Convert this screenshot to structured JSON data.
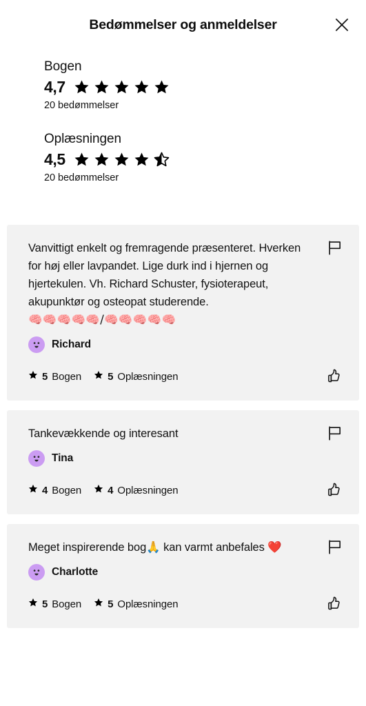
{
  "header": {
    "title": "Bedømmelser og anmeldelser",
    "close_label": "close-icon"
  },
  "summary": [
    {
      "label": "Bogen",
      "score": "4,7",
      "stars_full": 5,
      "stars_half": 0,
      "count_text": "20 bedømmelser"
    },
    {
      "label": "Oplæsningen",
      "score": "4,5",
      "stars_full": 4,
      "stars_half": 1,
      "count_text": "20 bedømmelser"
    }
  ],
  "reviews": [
    {
      "text": "Vanvittigt enkelt og fremragende præsenteret. Hverken for høj eller lavpandet. Lige durk ind i hjernen og hjertekulen. Vh. Richard Schuster, fysioterapeut, akupunktør og osteopat studerende.",
      "emoji_line": "🧠🧠🧠🧠🧠/🧠🧠🧠🧠🧠",
      "reviewer": "Richard",
      "ratings": [
        {
          "value": "5",
          "name": "Bogen"
        },
        {
          "value": "5",
          "name": "Oplæsningen"
        }
      ],
      "flag_label": "flag-icon",
      "like_label": "thumbs-up-icon"
    },
    {
      "text": "Tankevækkende og interesant",
      "emoji_line": "",
      "reviewer": "Tina",
      "ratings": [
        {
          "value": "4",
          "name": "Bogen"
        },
        {
          "value": "4",
          "name": "Oplæsningen"
        }
      ],
      "flag_label": "flag-icon",
      "like_label": "thumbs-up-icon"
    },
    {
      "text": "Meget inspirerende bog🙏 kan varmt anbefales ❤️",
      "emoji_line": "",
      "reviewer": "Charlotte",
      "ratings": [
        {
          "value": "5",
          "name": "Bogen"
        },
        {
          "value": "5",
          "name": "Oplæsningen"
        }
      ],
      "flag_label": "flag-icon",
      "like_label": "thumbs-up-icon"
    }
  ],
  "colors": {
    "page_background": "#ffffff",
    "card_background": "#f2f2f2",
    "text": "#111111",
    "avatar": "#cb9cf2",
    "star": "#000000"
  }
}
